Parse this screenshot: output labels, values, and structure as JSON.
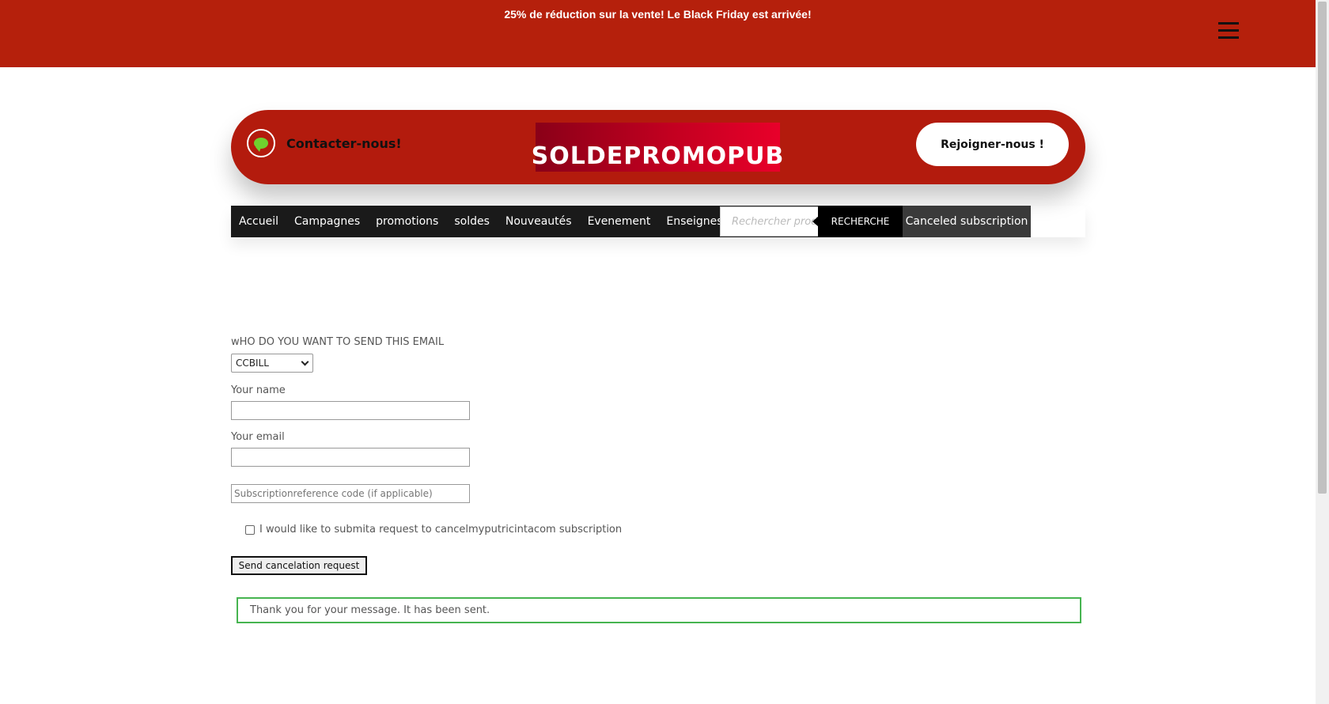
{
  "banner": {
    "promo_text": "25%  de réduction sur la vente! Le Black Friday est arrivée!",
    "menu_icon": "hamburger-menu-icon"
  },
  "header": {
    "contact_label": "Contacter-nous!",
    "contact_icon": "chat-bubble-icon",
    "logo_text": "SOLDEPROMOPUB",
    "join_button": "Rejoigner-nous !"
  },
  "nav": {
    "items": [
      "Accueil",
      "Campagnes",
      "promotions",
      "soldes",
      "Nouveautés",
      "Evenement",
      "Enseignes"
    ],
    "search_placeholder": "Rechercher produits",
    "search_button": "RECHERCHE",
    "canceled_link": "Canceled subscription"
  },
  "form": {
    "recipient_label": "wHO DO YOU WANT TO SEND THIS EMAIL",
    "recipient_selected": "CCBILL",
    "name_label": "Your name",
    "email_label": "Your email",
    "reference_placeholder": "Subscriptionreference code (if applicable)",
    "checkbox_label": "I would like to submita request to cancelmyputricintacom subscription",
    "submit_button": "Send cancelation request",
    "success_message": "Thank you for your message. It has been sent."
  },
  "colors": {
    "brand_red": "#b31b0d",
    "nav_dark": "#1a1a1a",
    "success_green": "#46b450",
    "chat_icon_green": "#6fd12e"
  }
}
